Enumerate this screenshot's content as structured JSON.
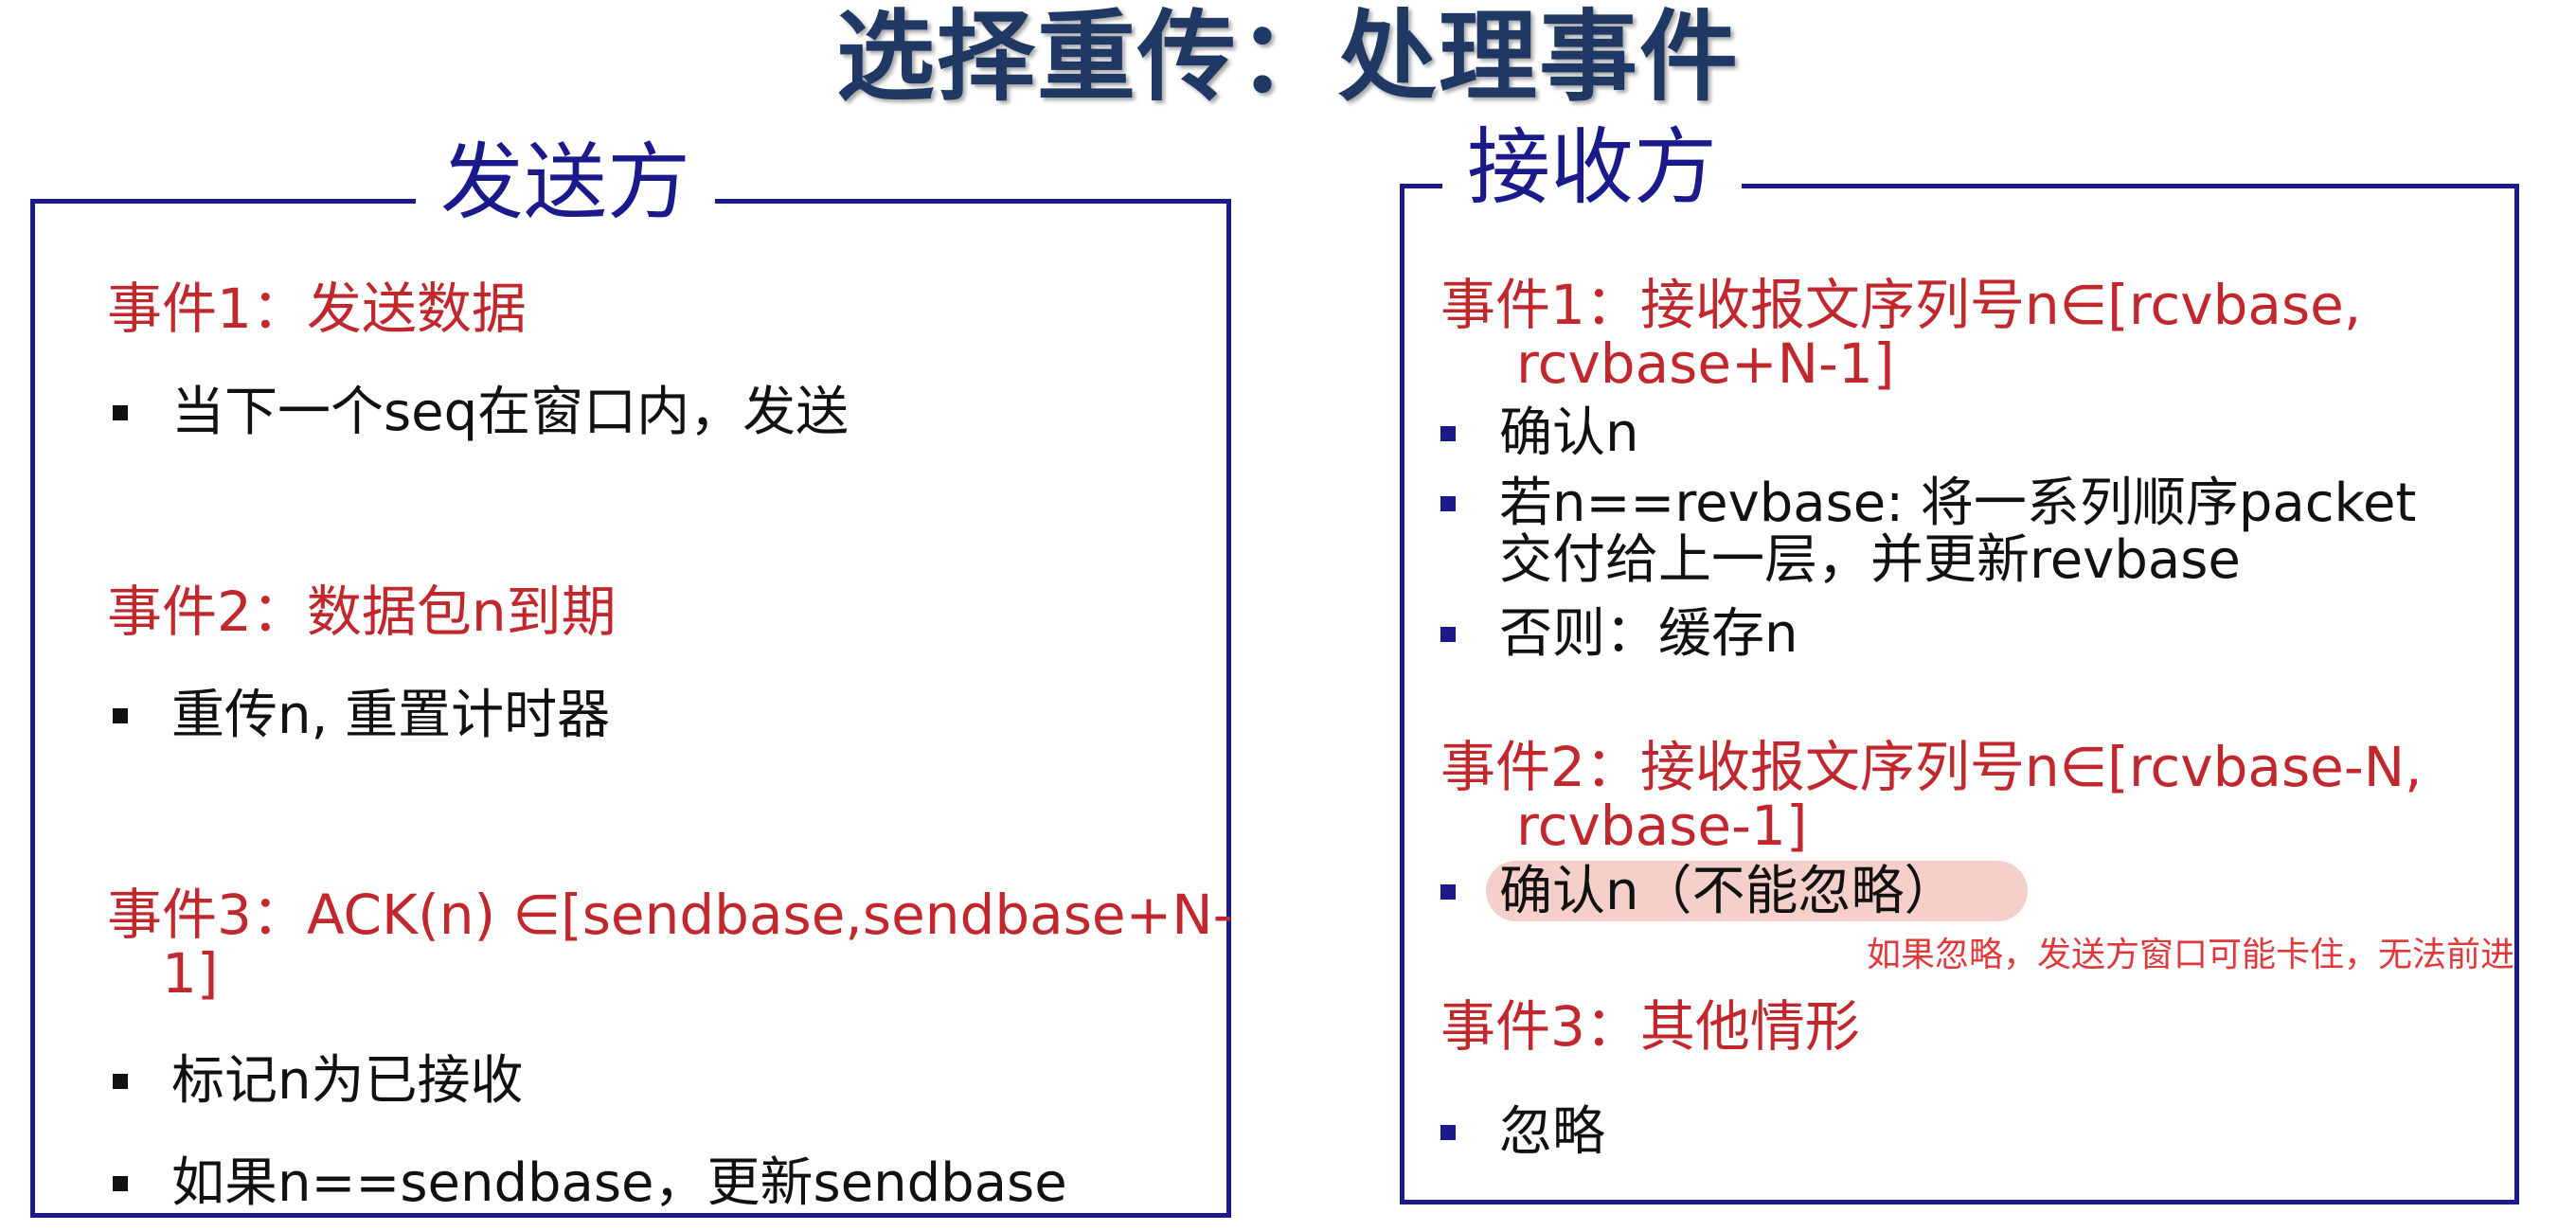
{
  "title": "选择重传：处理事件",
  "sender": {
    "heading": "发送方",
    "events": [
      {
        "title": "事件1：发送数据",
        "bullets": [
          "当下一个seq在窗口内，发送"
        ]
      },
      {
        "title": "事件2：数据包n到期",
        "bullets": [
          "重传n, 重置计时器"
        ]
      },
      {
        "title_line1": "事件3：ACK(n) ∈[sendbase,sendbase+N-",
        "title_line2": "1]",
        "bullets": [
          "标记n为已接收",
          "如果n==sendbase，更新sendbase"
        ]
      }
    ]
  },
  "receiver": {
    "heading": "接收方",
    "events": [
      {
        "title_line1": "事件1：接收报文序列号n∈[rcvbase,",
        "title_line2": "rcvbase+N-1]",
        "bullets": [
          {
            "line1": "确认n"
          },
          {
            "line1": "若n==revbase: 将一系列顺序packet",
            "line2": "交付给上一层，并更新revbase"
          },
          {
            "line1": "否则：缓存n"
          }
        ]
      },
      {
        "title_line1": "事件2：接收报文序列号n∈[rcvbase-N,",
        "title_line2": "rcvbase-1]",
        "bullets": [
          {
            "line1": "确认n（不能忽略）"
          }
        ],
        "annotation": "如果忽略，发送方窗口可能卡住，无法前进"
      },
      {
        "title": "事件3：其他情形",
        "bullets": [
          {
            "line1": "忽略"
          }
        ]
      }
    ]
  },
  "colors": {
    "title": "#1f3864",
    "frame": "#1a1a8c",
    "event": "#c0282d",
    "body_text": "#111111",
    "highlight": "#f5cfc9",
    "annotation": "#e0383b"
  }
}
